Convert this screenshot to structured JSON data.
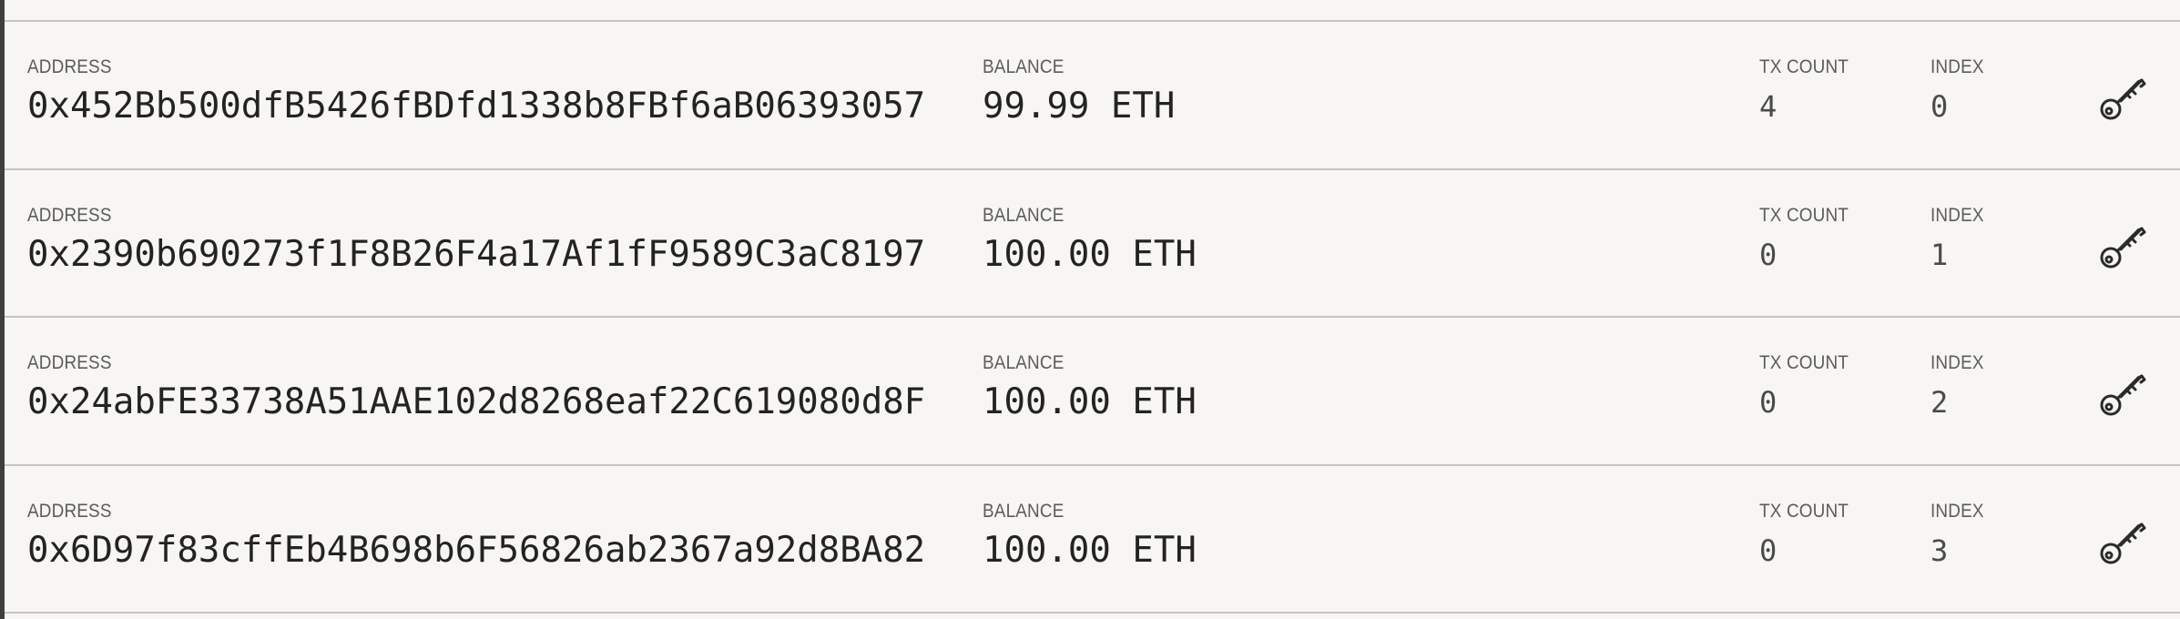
{
  "labels": {
    "address": "ADDRESS",
    "balance": "BALANCE",
    "tx_count": "TX COUNT",
    "index": "INDEX"
  },
  "accounts": [
    {
      "address": "0x452Bb500dfB5426fBDfd1338b8FBf6aB06393057",
      "balance": "99.99 ETH",
      "tx_count": "4",
      "index": "0"
    },
    {
      "address": "0x2390b690273f1F8B26F4a17Af1fF9589C3aC8197",
      "balance": "100.00 ETH",
      "tx_count": "0",
      "index": "1"
    },
    {
      "address": "0x24abFE33738A51AAE102d8268eaf22C619080d8F",
      "balance": "100.00 ETH",
      "tx_count": "0",
      "index": "2"
    },
    {
      "address": "0x6D97f83cffEb4B698b6F56826ab2367a92d8BA82",
      "balance": "100.00 ETH",
      "tx_count": "0",
      "index": "3"
    }
  ],
  "icons": {
    "key": "key-icon"
  },
  "colors": {
    "background": "#f7f6f3",
    "divider": "#c4c4c4",
    "text": "#232323",
    "label": "#5b5b5b"
  }
}
